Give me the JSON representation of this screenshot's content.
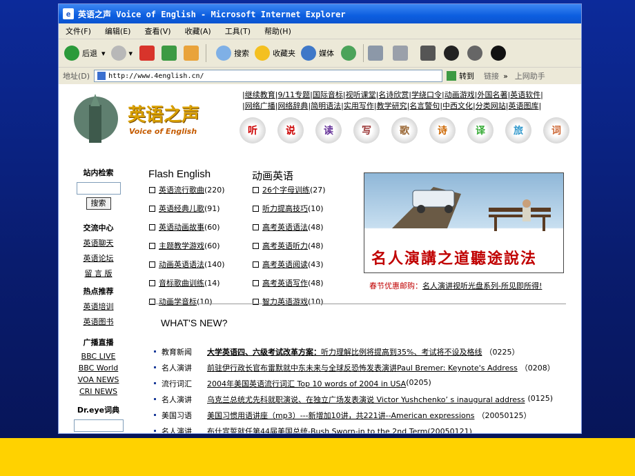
{
  "window": {
    "title": "英语之声 Voice of English - Microsoft Internet Explorer"
  },
  "menu": [
    "文件(F)",
    "编辑(E)",
    "查看(V)",
    "收藏(A)",
    "工具(T)",
    "帮助(H)"
  ],
  "toolbar": {
    "back": "后退",
    "search": "搜索",
    "favorites": "收藏夹",
    "media": "媒体"
  },
  "address": {
    "label": "地址(D)",
    "url": "http://www.4english.cn/",
    "go": "转到",
    "links": "链接",
    "assistant": "上网助手"
  },
  "logo": {
    "cn": "英语之声",
    "en": "Voice of English"
  },
  "top_links_row1": [
    "继续教育",
    "9/11专题",
    "国际音标",
    "视听课堂",
    "名诗欣赏",
    "学绕口令",
    "动画游戏",
    "外国名著",
    "英语软件"
  ],
  "top_links_row2": [
    "网络广播",
    "网络辞典",
    "简明语法",
    "实用写作",
    "教学研究",
    "名言警句",
    "中西文化",
    "分类网站",
    "英语图库"
  ],
  "icon_balls": [
    "听",
    "说",
    "读",
    "写",
    "歌",
    "诗",
    "译",
    "旅",
    "词"
  ],
  "sidebar": {
    "search_header": "站内检索",
    "search_button": "搜索",
    "exchange_header": "交流中心",
    "exchange_links": [
      "英语聊天",
      "英语论坛",
      "留 言 版"
    ],
    "hot_header": "热点推荐",
    "hot_links": [
      "英语培训",
      "英语图书"
    ],
    "broadcast_header": "广播直播",
    "broadcast_links": [
      "BBC  LIVE",
      "BBC World",
      "VOA NEWS",
      "CRI  NEWS"
    ],
    "dict_header": "Dr.eye词典"
  },
  "col1": {
    "header": "Flash English",
    "items": [
      {
        "t": "英语流行歌曲",
        "n": "(220)"
      },
      {
        "t": "英语经典儿歌",
        "n": "(91)"
      },
      {
        "t": "英语动画故事",
        "n": "(60)"
      },
      {
        "t": "主题教学游戏",
        "n": "(60)"
      },
      {
        "t": "动画英语语法",
        "n": "(140)"
      },
      {
        "t": "音标歌曲训练",
        "n": "(14)"
      },
      {
        "t": "动画学音标",
        "n": "(10)"
      }
    ]
  },
  "col2": {
    "header": "动画英语",
    "items": [
      {
        "t": "26个字母训练",
        "n": "(27)"
      },
      {
        "t": "听力提高技巧",
        "n": "(10)"
      },
      {
        "t": "高考英语语法",
        "n": "(48)"
      },
      {
        "t": "高考英语听力",
        "n": "(48)"
      },
      {
        "t": "高考英语阅读",
        "n": "(43)"
      },
      {
        "t": "高考英语写作",
        "n": "(48)"
      },
      {
        "t": "智力英语游戏",
        "n": "(10)"
      }
    ]
  },
  "banner": {
    "text": "名人演講之道聽途說法"
  },
  "promo": {
    "label": "春节优惠邮购：",
    "link": "名人演讲视听光盘系列-所见即所得!"
  },
  "whats_new": "WHAT'S NEW?",
  "news": [
    {
      "cat": "教育新闻",
      "title": "大学英语四、六级考试改革方案：",
      "rest": "听力理解比例将提高到35%、考试将不设及格线",
      "date": "（0225）"
    },
    {
      "cat": "名人演讲",
      "title": "前驻伊行政长官布雷默就中东未来与全球反恐怖发表演讲Paul Bremer: Keynote's Address",
      "rest": "",
      "date": "（0208）"
    },
    {
      "cat": "流行词汇",
      "title": "2004年美国英语流行词汇  Top 10 words of 2004 in USA",
      "rest": "",
      "date": "(0205)"
    },
    {
      "cat": "名人演讲",
      "title": "乌克兰总统尤先科就职演说、在独立广场发表演说  Victor Yushchenko’ s inaugural address",
      "rest": "",
      "date": "(0125)"
    },
    {
      "cat": "美国习语",
      "title": "美国习惯用语讲座（mp3）---新增加10讲，共221讲--American expressions",
      "rest": "",
      "date": "（20050125）"
    },
    {
      "cat": "名人演讲",
      "title": "布什宣誓就任第44届美国总统-Bush Sworn-in to the 2nd Term(20050121)",
      "rest": "",
      "date": ""
    }
  ]
}
